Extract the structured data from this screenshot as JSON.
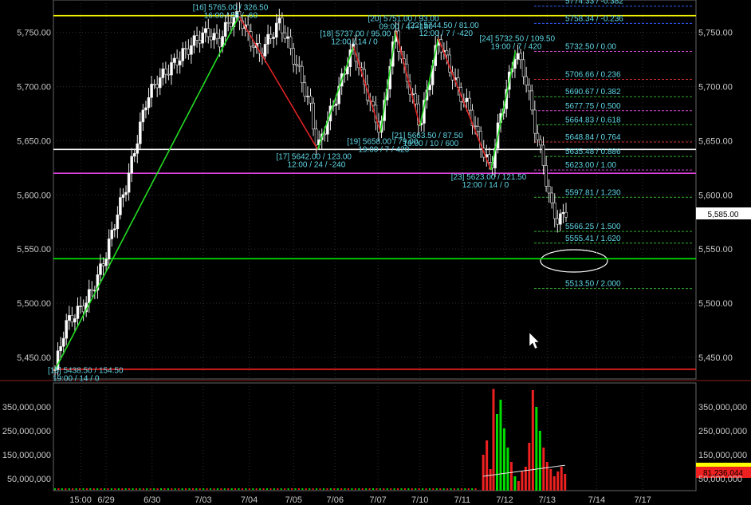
{
  "chart_data": [
    {
      "type": "candlestick",
      "title": "",
      "ylim": [
        5430,
        5780
      ],
      "yticks": [
        "5,750.00",
        "5,700.00",
        "5,650.00",
        "5,600.00",
        "5,550.00",
        "5,500.00",
        "5,450.00"
      ],
      "ytick_values": [
        5750,
        5700,
        5650,
        5600,
        5550,
        5500,
        5450
      ],
      "xticks": [
        "15:00",
        "6/29",
        "6/30",
        "7/03",
        "7/04",
        "7/05",
        "7/06",
        "7/07",
        "7/10",
        "7/11",
        "7/12",
        "7/13",
        "7/14",
        "7/17"
      ],
      "last_price": "5,585.00",
      "horizontal_levels": [
        {
          "value": 5765.5,
          "color": "#ffff00"
        },
        {
          "value": 5642.0,
          "color": "#ffffff"
        },
        {
          "value": 5620.0,
          "color": "#dd44dd"
        },
        {
          "value": 5541.0,
          "color": "#00ee00"
        },
        {
          "value": 5439.0,
          "color": "#ff2020"
        }
      ],
      "fib_levels": [
        {
          "label": "5774.33 / -0.382",
          "value": 5774.33,
          "color": "#3060ff"
        },
        {
          "label": "5758.34 / -0.236",
          "value": 5758.34,
          "color": "#3060ff"
        },
        {
          "label": "5732.50 / 0.00",
          "value": 5732.5,
          "color": "#cc44cc"
        },
        {
          "label": "5706.66 / 0.236",
          "value": 5706.66,
          "color": "#cc3030"
        },
        {
          "label": "5690.67 / 0.382",
          "value": 5690.67,
          "color": "#30b030"
        },
        {
          "label": "5677.75 / 0.500",
          "value": 5677.75,
          "color": "#cc44cc"
        },
        {
          "label": "5664.83 / 0.618",
          "value": 5664.83,
          "color": "#30b030"
        },
        {
          "label": "5648.84 / 0.764",
          "value": 5648.84,
          "color": "#cc3030"
        },
        {
          "label": "5635.48 / 0.886",
          "value": 5635.48,
          "color": "#30b030"
        },
        {
          "label": "5623.00 / 1.00",
          "value": 5623.0,
          "color": "#cc44cc"
        },
        {
          "label": "5597.81 / 1.230",
          "value": 5597.81,
          "color": "#30b030"
        },
        {
          "label": "5566.25 / 1.500",
          "value": 5566.25,
          "color": "#30b030"
        },
        {
          "label": "5555.41 / 1.620",
          "value": 5555.41,
          "color": "#30b030"
        },
        {
          "label": "5513.50 / 2.000",
          "value": 5513.5,
          "color": "#30b030"
        }
      ],
      "swing_labels": [
        {
          "line1": "[16] 5765.00 / 326.50",
          "line2": "16:00 / 55 / -60"
        },
        {
          "line1": "[17] 5642.00 / 123.00",
          "line2": "12:00 / 24 / -240"
        },
        {
          "line1": "[18] 5737.00 / 95.00",
          "line2": "12:00 / 14 / 0"
        },
        {
          "line1": "[19] 5658.00 / 79.00",
          "line2": "19:00 / 7 / 420"
        },
        {
          "line1": "[20] 5751.00 / 93.00",
          "line2": "09:00 / 4 / -180"
        },
        {
          "line1": "[21] 5663.50 / 87.50",
          "line2": "19:00 / 10 / 600"
        },
        {
          "line1": "[22] 5744.50 / 81.00",
          "line2": "12:00 / 7 / -420"
        },
        {
          "line1": "[23] 5623.00 / 121.50",
          "line2": "12:00 / 14 / 0"
        },
        {
          "line1": "[24] 5732.50 / 109.50",
          "line2": "19:00 / 7 / 420"
        },
        {
          "line1": "[15] 5438.50 / 154.50",
          "line2": "19:00 / 14 / 0"
        }
      ],
      "swing_points": [
        {
          "t": 0.0,
          "price": 5438.5,
          "dir": "low"
        },
        {
          "t": 0.36,
          "price": 5765.0,
          "dir": "high"
        },
        {
          "t": 0.514,
          "price": 5642.0,
          "dir": "low"
        },
        {
          "t": 0.584,
          "price": 5737.0,
          "dir": "high"
        },
        {
          "t": 0.637,
          "price": 5658.0,
          "dir": "low"
        },
        {
          "t": 0.667,
          "price": 5751.0,
          "dir": "high"
        },
        {
          "t": 0.714,
          "price": 5663.5,
          "dir": "low"
        },
        {
          "t": 0.75,
          "price": 5744.5,
          "dir": "high"
        },
        {
          "t": 0.853,
          "price": 5623.0,
          "dir": "low"
        },
        {
          "t": 0.901,
          "price": 5732.5,
          "dir": "high"
        }
      ],
      "price_path": [
        [
          0.0,
          5438.5
        ],
        [
          0.02,
          5480
        ],
        [
          0.04,
          5490
        ],
        [
          0.06,
          5500
        ],
        [
          0.08,
          5520
        ],
        [
          0.1,
          5545
        ],
        [
          0.12,
          5580
        ],
        [
          0.14,
          5610
        ],
        [
          0.16,
          5650
        ],
        [
          0.18,
          5690
        ],
        [
          0.2,
          5705
        ],
        [
          0.22,
          5715
        ],
        [
          0.24,
          5725
        ],
        [
          0.26,
          5735
        ],
        [
          0.28,
          5745
        ],
        [
          0.3,
          5750
        ],
        [
          0.32,
          5740
        ],
        [
          0.34,
          5760
        ],
        [
          0.36,
          5765
        ],
        [
          0.38,
          5745
        ],
        [
          0.4,
          5730
        ],
        [
          0.42,
          5745
        ],
        [
          0.44,
          5760
        ],
        [
          0.46,
          5735
        ],
        [
          0.48,
          5710
        ],
        [
          0.5,
          5680
        ],
        [
          0.514,
          5642
        ],
        [
          0.53,
          5665
        ],
        [
          0.55,
          5690
        ],
        [
          0.57,
          5720
        ],
        [
          0.584,
          5737
        ],
        [
          0.6,
          5710
        ],
        [
          0.62,
          5680
        ],
        [
          0.637,
          5658
        ],
        [
          0.655,
          5720
        ],
        [
          0.667,
          5751
        ],
        [
          0.68,
          5720
        ],
        [
          0.7,
          5690
        ],
        [
          0.714,
          5663.5
        ],
        [
          0.73,
          5700
        ],
        [
          0.75,
          5744.5
        ],
        [
          0.77,
          5720
        ],
        [
          0.79,
          5695
        ],
        [
          0.81,
          5680
        ],
        [
          0.83,
          5650
        ],
        [
          0.853,
          5623
        ],
        [
          0.87,
          5670
        ],
        [
          0.89,
          5710
        ],
        [
          0.901,
          5732.5
        ],
        [
          0.92,
          5710
        ],
        [
          0.94,
          5660
        ],
        [
          0.955,
          5630
        ],
        [
          0.97,
          5590
        ],
        [
          0.985,
          5575
        ],
        [
          1.0,
          5585
        ]
      ]
    },
    {
      "type": "bar",
      "title": "",
      "ylim": [
        0,
        450000000
      ],
      "yticks": [
        "350,000,000",
        "250,000,000",
        "150,000,000",
        "50,000,000"
      ],
      "ytick_values": [
        350000000,
        250000000,
        150000000,
        50000000
      ],
      "last_value": "81,236,044",
      "volume_colors": {
        "up": "#00dd00",
        "down": "#ee2020",
        "avg": "#e8e8e8"
      },
      "bars": [
        {
          "t": 0.838,
          "v": 150000000,
          "up": false
        },
        {
          "t": 0.845,
          "v": 210000000,
          "up": false
        },
        {
          "t": 0.852,
          "v": 90000000,
          "up": false
        },
        {
          "t": 0.858,
          "v": 425000000,
          "up": false
        },
        {
          "t": 0.865,
          "v": 320000000,
          "up": true
        },
        {
          "t": 0.872,
          "v": 380000000,
          "up": true
        },
        {
          "t": 0.879,
          "v": 260000000,
          "up": true
        },
        {
          "t": 0.886,
          "v": 180000000,
          "up": true
        },
        {
          "t": 0.893,
          "v": 120000000,
          "up": false
        },
        {
          "t": 0.9,
          "v": 60000000,
          "up": true
        },
        {
          "t": 0.907,
          "v": 40000000,
          "up": false
        },
        {
          "t": 0.914,
          "v": 80000000,
          "up": false
        },
        {
          "t": 0.921,
          "v": 100000000,
          "up": false
        },
        {
          "t": 0.928,
          "v": 200000000,
          "up": false
        },
        {
          "t": 0.935,
          "v": 420000000,
          "up": false
        },
        {
          "t": 0.942,
          "v": 350000000,
          "up": true
        },
        {
          "t": 0.949,
          "v": 250000000,
          "up": true
        },
        {
          "t": 0.956,
          "v": 180000000,
          "up": false
        },
        {
          "t": 0.963,
          "v": 120000000,
          "up": false
        },
        {
          "t": 0.97,
          "v": 90000000,
          "up": false
        },
        {
          "t": 0.977,
          "v": 60000000,
          "up": false
        },
        {
          "t": 0.984,
          "v": 80000000,
          "up": false
        },
        {
          "t": 0.991,
          "v": 100000000,
          "up": false
        },
        {
          "t": 0.998,
          "v": 70000000,
          "up": false
        }
      ]
    }
  ]
}
